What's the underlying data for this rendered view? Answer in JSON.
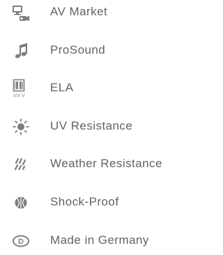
{
  "features": [
    {
      "label": "AV Market",
      "icon": "monitor-camera-icon"
    },
    {
      "label": "ProSound",
      "icon": "music-note-icon"
    },
    {
      "label": "ELA",
      "icon": "ela-100v-icon",
      "icon_caption": "100 V"
    },
    {
      "label": "UV Resistance",
      "icon": "sun-icon"
    },
    {
      "label": "Weather Resistance",
      "icon": "rain-icon"
    },
    {
      "label": "Shock-Proof",
      "icon": "ball-icon"
    },
    {
      "label": "Made in Germany",
      "icon": "d-badge-icon",
      "icon_caption": "D"
    }
  ],
  "colors": {
    "label_text": "#5e636a",
    "icon": "#7a7e84",
    "background": "#ffffff"
  }
}
